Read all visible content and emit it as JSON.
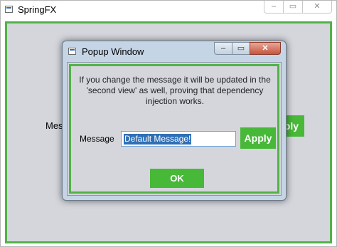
{
  "main_window": {
    "title": "SpringFX",
    "controls": {
      "minimize": "–",
      "maximize": "▭",
      "close": "✕"
    },
    "background": {
      "message_label": "Message",
      "apply_label": "Apply"
    }
  },
  "popup": {
    "title": "Popup Window",
    "controls": {
      "minimize": "–",
      "maximize": "▭",
      "close": "✕"
    },
    "info_text": "If you change the message it will be updated in the 'second view' as well, proving that dependency injection works.",
    "message_label": "Message",
    "message_value": "Default Message!",
    "apply_label": "Apply",
    "ok_label": "OK"
  },
  "colors": {
    "accent_green": "#48b838",
    "frame_green": "#52b248",
    "selection_blue": "#2f6fb5"
  }
}
